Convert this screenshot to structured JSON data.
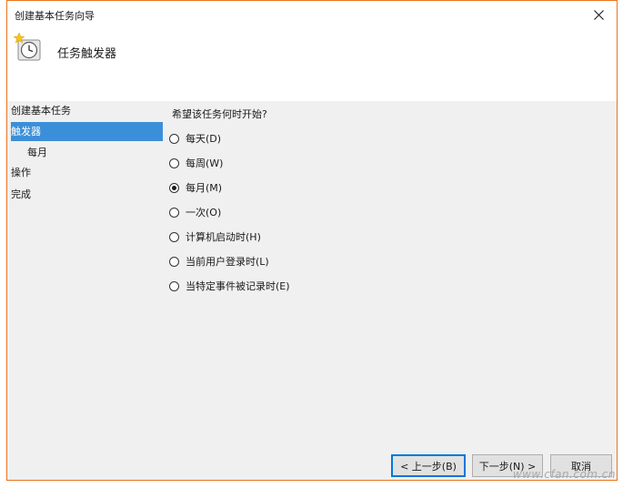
{
  "window": {
    "title": "创建基本任务向导"
  },
  "header": {
    "title": "任务触发器"
  },
  "sidebar": {
    "items": [
      {
        "label": "创建基本任务"
      },
      {
        "label": "触发器"
      },
      {
        "label": "每月"
      },
      {
        "label": "操作"
      },
      {
        "label": "完成"
      }
    ]
  },
  "main": {
    "question": "希望该任务何时开始?",
    "options": [
      {
        "label": "每天(D)",
        "checked": false
      },
      {
        "label": "每周(W)",
        "checked": false
      },
      {
        "label": "每月(M)",
        "checked": true
      },
      {
        "label": "一次(O)",
        "checked": false
      },
      {
        "label": "计算机启动时(H)",
        "checked": false
      },
      {
        "label": "当前用户登录时(L)",
        "checked": false
      },
      {
        "label": "当特定事件被记录时(E)",
        "checked": false
      }
    ]
  },
  "buttons": {
    "back": "< 上一步(B)",
    "next": "下一步(N) >",
    "cancel": "取消"
  },
  "watermark": "www.cfan.com.cn",
  "colors": {
    "accent": "#e8741f",
    "selection": "#3b8fd9",
    "default_button_border": "#0078d7"
  }
}
